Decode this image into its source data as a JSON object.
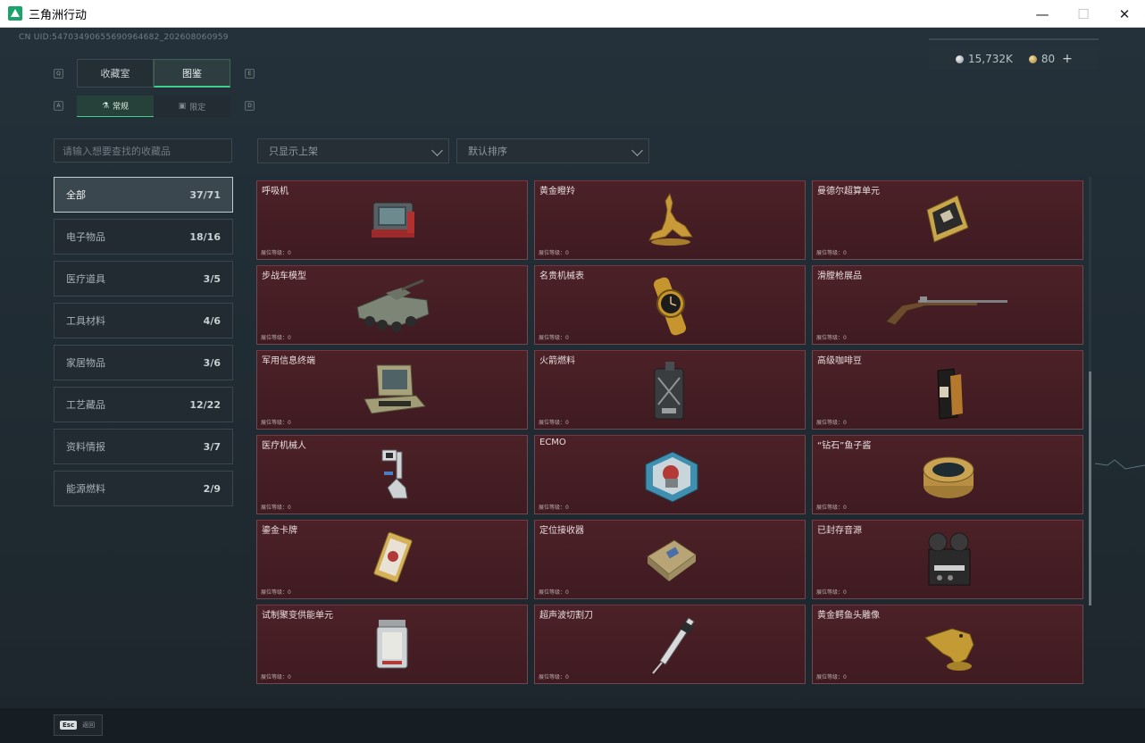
{
  "window": {
    "title": "三角洲行动",
    "minimize": "—",
    "maximize": "☐",
    "close": "✕"
  },
  "uid": "CN UID:54703490655690964682_202608060959",
  "currency": {
    "silver": "15,732K",
    "gold": "80",
    "add": "+"
  },
  "keys": {
    "q": "Q",
    "e": "E",
    "a": "A",
    "d": "D"
  },
  "tabs": [
    {
      "label": "收藏室",
      "active": false
    },
    {
      "label": "图鉴",
      "active": true
    }
  ],
  "subtabs": [
    {
      "label": "常规",
      "active": true,
      "icon": "flask-icon"
    },
    {
      "label": "限定",
      "active": false,
      "icon": "star-box-icon"
    }
  ],
  "search": {
    "placeholder": "请输入想要查找的收藏品"
  },
  "filters": {
    "display": "只显示上架",
    "sort": "默认排序"
  },
  "categories": [
    {
      "label": "全部",
      "count": "37/71",
      "active": true
    },
    {
      "label": "电子物品",
      "count": "18/16"
    },
    {
      "label": "医疗道具",
      "count": "3/5"
    },
    {
      "label": "工具材料",
      "count": "4/6"
    },
    {
      "label": "家居物品",
      "count": "3/6"
    },
    {
      "label": "工艺藏品",
      "count": "12/22"
    },
    {
      "label": "资料情报",
      "count": "3/7"
    },
    {
      "label": "能源燃料",
      "count": "2/9"
    }
  ],
  "level_label": "展位等级：0",
  "items": [
    {
      "name": "呼吸机",
      "icon": "ventilator-icon"
    },
    {
      "name": "黄金瞪羚",
      "icon": "gold-gazelle-icon"
    },
    {
      "name": "曼德尔超算单元",
      "icon": "supercomputer-unit-icon"
    },
    {
      "name": "步战车模型",
      "icon": "ifv-model-icon"
    },
    {
      "name": "名贵机械表",
      "icon": "gold-watch-icon"
    },
    {
      "name": "滑膛枪展品",
      "icon": "musket-icon"
    },
    {
      "name": "军用信息终端",
      "icon": "military-terminal-icon"
    },
    {
      "name": "火箭燃料",
      "icon": "fuel-can-icon"
    },
    {
      "name": "高级咖啡豆",
      "icon": "coffee-bag-icon"
    },
    {
      "name": "医疗机械人",
      "icon": "medical-robot-icon"
    },
    {
      "name": "ECMO",
      "icon": "ecmo-icon"
    },
    {
      "name": "“钻石”鱼子酱",
      "icon": "caviar-tin-icon"
    },
    {
      "name": "鎏金卡牌",
      "icon": "gilded-card-icon"
    },
    {
      "name": "定位接收器",
      "icon": "receiver-icon"
    },
    {
      "name": "已封存音源",
      "icon": "reel-recorder-icon"
    },
    {
      "name": "试制聚变供能单元",
      "icon": "fusion-cell-icon"
    },
    {
      "name": "超声波切割刀",
      "icon": "ultrasonic-knife-icon"
    },
    {
      "name": "黄金鳄鱼头雕像",
      "icon": "gold-croc-statue-icon"
    }
  ],
  "footer": {
    "esc": "Esc",
    "back": "返回"
  },
  "colors": {
    "accent": "#3fcf8e",
    "card_bg": "#4b2127",
    "bg": "#1f2a31"
  }
}
